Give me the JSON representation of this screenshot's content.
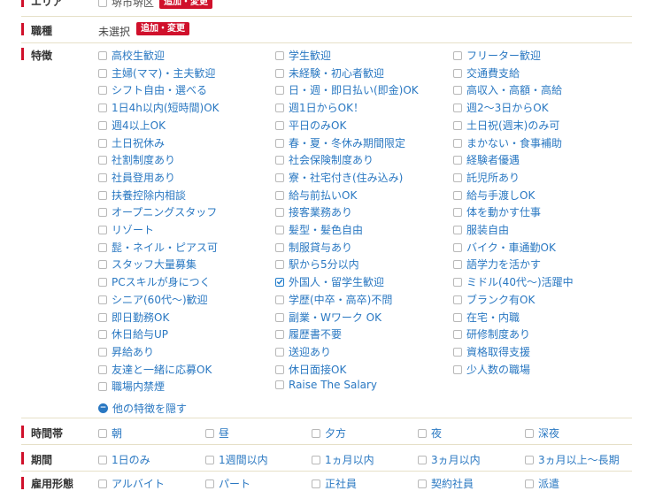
{
  "area": {
    "label": "エリア",
    "value": "堺市堺区",
    "button": "追加・変更"
  },
  "job_type": {
    "label": "職種",
    "value": "未選択",
    "button": "追加・変更"
  },
  "features": {
    "label": "特徴",
    "items": [
      {
        "text": "高校生歓迎",
        "checked": false
      },
      {
        "text": "学生歓迎",
        "checked": false
      },
      {
        "text": "フリーター歓迎",
        "checked": false
      },
      {
        "text": "主婦(ママ)・主夫歓迎",
        "checked": false
      },
      {
        "text": "未経験・初心者歓迎",
        "checked": false
      },
      {
        "text": "交通費支給",
        "checked": false
      },
      {
        "text": "シフト自由・選べる",
        "checked": false
      },
      {
        "text": "日・週・即日払い(即金)OK",
        "checked": false
      },
      {
        "text": "高収入・高額・高給",
        "checked": false
      },
      {
        "text": "1日4h以内(短時間)OK",
        "checked": false
      },
      {
        "text": "週1日からOK！",
        "checked": false
      },
      {
        "text": "週2〜3日からOK",
        "checked": false
      },
      {
        "text": "週4以上OK",
        "checked": false
      },
      {
        "text": "平日のみOK",
        "checked": false
      },
      {
        "text": "土日祝(週末)のみ可",
        "checked": false
      },
      {
        "text": "土日祝休み",
        "checked": false
      },
      {
        "text": "春・夏・冬休み期間限定",
        "checked": false
      },
      {
        "text": "まかない・食事補助",
        "checked": false
      },
      {
        "text": "社割制度あり",
        "checked": false
      },
      {
        "text": "社会保険制度あり",
        "checked": false
      },
      {
        "text": "経験者優遇",
        "checked": false
      },
      {
        "text": "社員登用あり",
        "checked": false
      },
      {
        "text": "寮・社宅付き(住み込み)",
        "checked": false
      },
      {
        "text": "託児所あり",
        "checked": false
      },
      {
        "text": "扶養控除内相談",
        "checked": false
      },
      {
        "text": "給与前払いOK",
        "checked": false
      },
      {
        "text": "給与手渡しOK",
        "checked": false
      },
      {
        "text": "オープニングスタッフ",
        "checked": false
      },
      {
        "text": "接客業務あり",
        "checked": false
      },
      {
        "text": "体を動かす仕事",
        "checked": false
      },
      {
        "text": "リゾート",
        "checked": false
      },
      {
        "text": "髪型・髪色自由",
        "checked": false
      },
      {
        "text": "服装自由",
        "checked": false
      },
      {
        "text": "髭・ネイル・ピアス可",
        "checked": false
      },
      {
        "text": "制服貸与あり",
        "checked": false
      },
      {
        "text": "バイク・車通勤OK",
        "checked": false
      },
      {
        "text": "スタッフ大量募集",
        "checked": false
      },
      {
        "text": "駅から5分以内",
        "checked": false
      },
      {
        "text": "語学力を活かす",
        "checked": false
      },
      {
        "text": "PCスキルが身につく",
        "checked": false
      },
      {
        "text": "外国人・留学生歓迎",
        "checked": true
      },
      {
        "text": "ミドル(40代〜)活躍中",
        "checked": false
      },
      {
        "text": "シニア(60代〜)歓迎",
        "checked": false
      },
      {
        "text": "学歴(中卒・高卒)不問",
        "checked": false
      },
      {
        "text": "ブランク有OK",
        "checked": false
      },
      {
        "text": "即日勤務OK",
        "checked": false
      },
      {
        "text": "副業・Wワーク OK",
        "checked": false
      },
      {
        "text": "在宅・内職",
        "checked": false
      },
      {
        "text": "休日給与UP",
        "checked": false
      },
      {
        "text": "履歴書不要",
        "checked": false
      },
      {
        "text": "研修制度あり",
        "checked": false
      },
      {
        "text": "昇給あり",
        "checked": false
      },
      {
        "text": "送迎あり",
        "checked": false
      },
      {
        "text": "資格取得支援",
        "checked": false
      },
      {
        "text": "友達と一緒に応募OK",
        "checked": false
      },
      {
        "text": "休日面接OK",
        "checked": false
      },
      {
        "text": "少人数の職場",
        "checked": false
      },
      {
        "text": "職場内禁煙",
        "checked": false
      },
      {
        "text": "Raise The Salary",
        "checked": false
      }
    ],
    "hide_link": "他の特徴を隠す",
    "hide_icon": "−"
  },
  "time_zone": {
    "label": "時間帯",
    "items": [
      {
        "text": "朝",
        "checked": false
      },
      {
        "text": "昼",
        "checked": false
      },
      {
        "text": "夕方",
        "checked": false
      },
      {
        "text": "夜",
        "checked": false
      },
      {
        "text": "深夜",
        "checked": false
      }
    ]
  },
  "period": {
    "label": "期間",
    "items": [
      {
        "text": "1日のみ",
        "checked": false
      },
      {
        "text": "1週間以内",
        "checked": false
      },
      {
        "text": "1ヵ月以内",
        "checked": false
      },
      {
        "text": "3ヵ月以内",
        "checked": false
      },
      {
        "text": "3ヵ月以上〜長期",
        "checked": false
      }
    ]
  },
  "employment": {
    "label": "雇用形態",
    "items": [
      {
        "text": "アルバイト",
        "checked": false
      },
      {
        "text": "パート",
        "checked": false
      },
      {
        "text": "正社員",
        "checked": false
      },
      {
        "text": "契約社員",
        "checked": false
      },
      {
        "text": "派遣",
        "checked": false
      }
    ]
  }
}
